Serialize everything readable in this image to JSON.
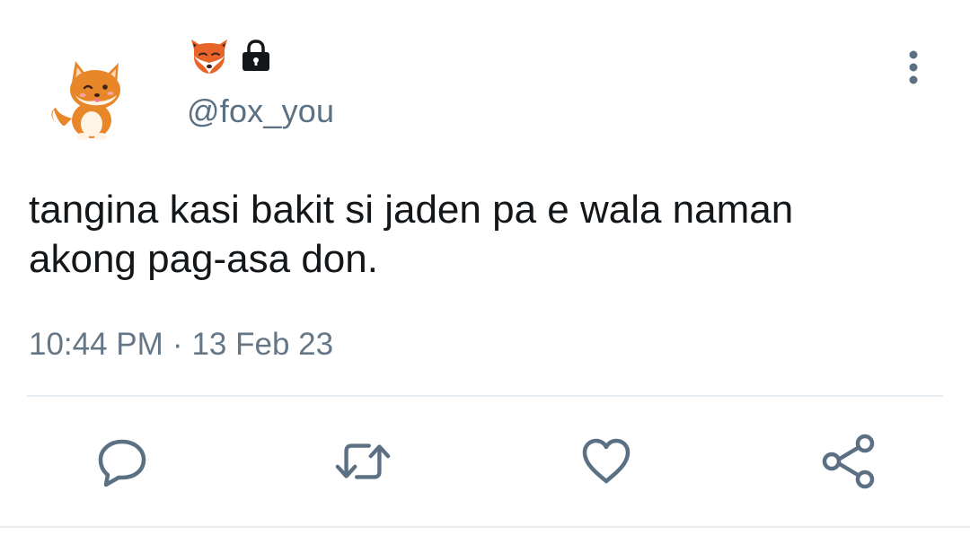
{
  "user": {
    "handle": "@fox_you",
    "display_name_icons": [
      "fox-face-icon",
      "lock-icon"
    ],
    "avatar": "fox-cartoon-avatar"
  },
  "tweet": {
    "text": "tangina kasi bakit si jaden pa e wala naman\nakong pag-asa don.",
    "time": "10:44 PM",
    "separator": "·",
    "date": "13 Feb 23"
  },
  "actions": [
    "reply-icon",
    "retweet-icon",
    "like-icon",
    "share-icon"
  ],
  "colors": {
    "text": "#14171a",
    "muted": "#657786",
    "icon": "#5b7083",
    "divider": "#e6ecf0"
  }
}
